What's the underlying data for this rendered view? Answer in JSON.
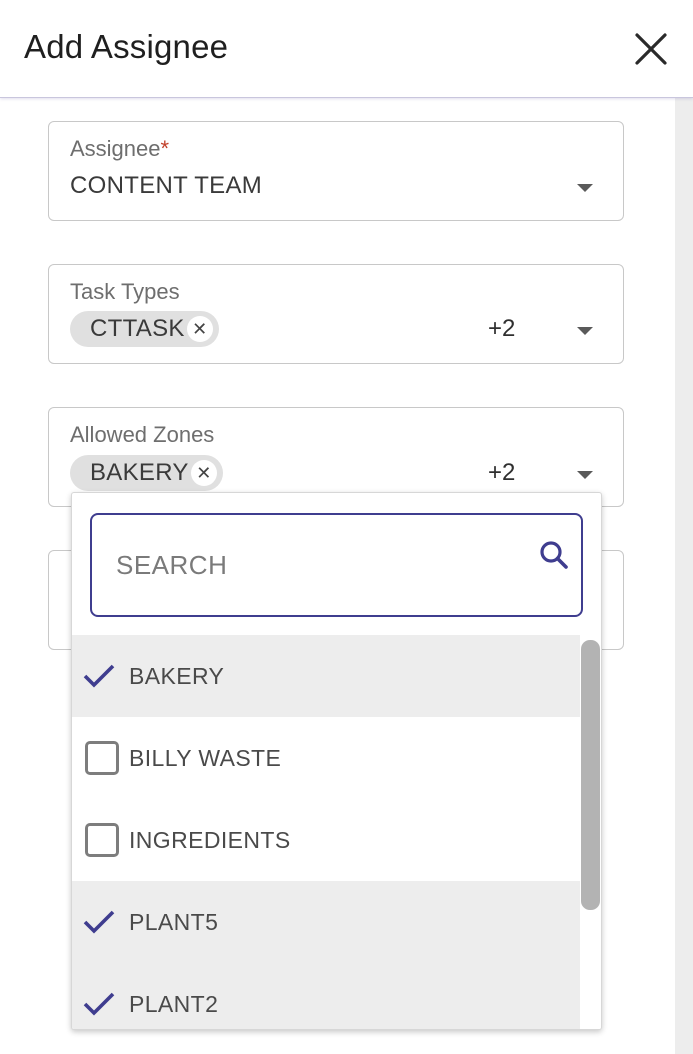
{
  "dialog": {
    "title": "Add Assignee"
  },
  "assignee": {
    "label": "Assignee",
    "required_mark": "*",
    "value": "CONTENT TEAM"
  },
  "task_types": {
    "label": "Task Types",
    "chip": "CTTASK",
    "more": "+2"
  },
  "allowed_zones": {
    "label": "Allowed Zones",
    "chip": "BAKERY",
    "more": "+2"
  },
  "dropdown": {
    "search_placeholder": "SEARCH",
    "options": [
      {
        "label": "BAKERY",
        "selected": true
      },
      {
        "label": "BILLY WASTE",
        "selected": false
      },
      {
        "label": "INGREDIENTS",
        "selected": false
      },
      {
        "label": "PLANT5",
        "selected": true
      },
      {
        "label": "PLANT2",
        "selected": true
      }
    ]
  },
  "colors": {
    "accent": "#3f3d8f",
    "required": "#c2402a",
    "selected_row": "#ededed"
  },
  "icons": {
    "close": "close-icon",
    "caret": "chevron-down-icon",
    "search": "search-icon",
    "check": "check-icon",
    "chip_remove": "close-icon"
  }
}
